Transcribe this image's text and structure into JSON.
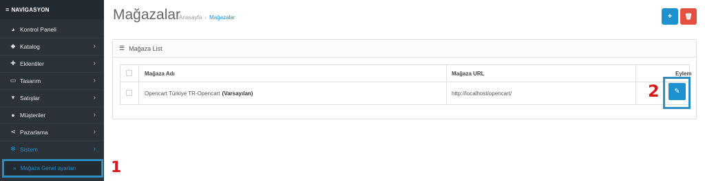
{
  "sidebar": {
    "heading": "NAVİGASYON",
    "items": [
      {
        "label": "Kontrol Paneli",
        "icon": "dashboard-icon",
        "glyph": "◕",
        "chevron": ""
      },
      {
        "label": "Katalog",
        "icon": "tag-icon",
        "glyph": "◆",
        "chevron": "›"
      },
      {
        "label": "Eklentiler",
        "icon": "puzzle-icon",
        "glyph": "✚",
        "chevron": "›"
      },
      {
        "label": "Tasarım",
        "icon": "monitor-icon",
        "glyph": "▭",
        "chevron": "›"
      },
      {
        "label": "Satışlar",
        "icon": "cart-icon",
        "glyph": "▾",
        "chevron": "›"
      },
      {
        "label": "Müşteriler",
        "icon": "user-icon",
        "glyph": "●",
        "chevron": "›"
      },
      {
        "label": "Pazarlama",
        "icon": "share-icon",
        "glyph": "⋖",
        "chevron": "›"
      },
      {
        "label": "Sistem",
        "icon": "gear-icon",
        "glyph": "✻",
        "chevron": "›"
      }
    ],
    "subitem": {
      "label": "Mağaza Genel ayarları",
      "prefix": "»"
    }
  },
  "annotations": {
    "one": "1",
    "two": "2"
  },
  "header": {
    "title": "Mağazalar",
    "breadcrumb": {
      "home": "Anasayfa",
      "separator": "›",
      "current": "Mağazalar"
    },
    "add_glyph": "+",
    "delete_glyph": "🗑"
  },
  "panel": {
    "title": "Mağaza List",
    "columns": {
      "name": "Mağaza Adı",
      "url": "Mağaza URL",
      "action": "Eylem"
    },
    "rows": [
      {
        "name": "Opencart Türkiye TR-Opencart",
        "default_tag": "(Varsayılan)",
        "url": "http://localhost/opencart/",
        "edit_glyph": "✎"
      }
    ]
  },
  "colors": {
    "sidebar_bg": "#2b323a",
    "accent": "#1e91cf",
    "danger": "#e3503e",
    "callout": "#d8171a"
  }
}
